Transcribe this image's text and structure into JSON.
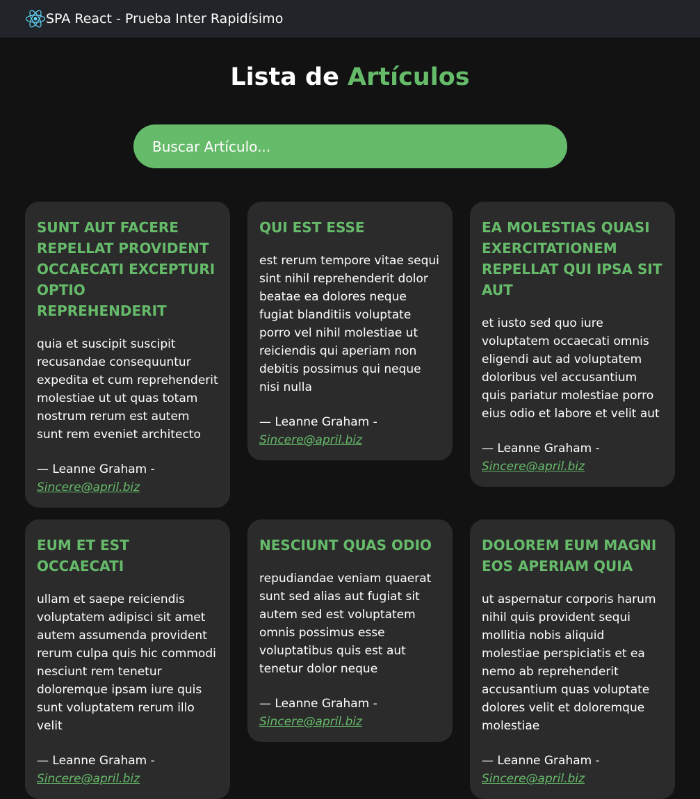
{
  "navbar": {
    "brand": "SPA React - Prueba Inter Rapidísimo",
    "logo_icon": "react-atom-icon",
    "logo_color": "#61dafb"
  },
  "title": {
    "prefix": "Lista de",
    "accent": "Artículos"
  },
  "search": {
    "placeholder": "Buscar Artículo..."
  },
  "colors": {
    "accent": "#66bb6a",
    "background": "#121212",
    "card": "#2b2b2b",
    "navbar": "#212428"
  },
  "articles": [
    {
      "title": "sunt aut facere repellat provident occaecati excepturi optio reprehenderit",
      "body": "quia et suscipit suscipit recusandae consequuntur expedita et cum reprehenderit molestiae ut ut quas totam nostrum rerum est autem sunt rem eveniet architecto",
      "author": "— Leanne Graham -",
      "email": "Sincere@april.biz"
    },
    {
      "title": "qui est esse",
      "body": "est rerum tempore vitae sequi sint nihil reprehenderit dolor beatae ea dolores neque fugiat blanditiis voluptate porro vel nihil molestiae ut reiciendis qui aperiam non debitis possimus qui neque nisi nulla",
      "author": "— Leanne Graham -",
      "email": "Sincere@april.biz"
    },
    {
      "title": "ea molestias quasi exercitationem repellat qui ipsa sit aut",
      "body": "et iusto sed quo iure voluptatem occaecati omnis eligendi aut ad voluptatem doloribus vel accusantium quis pariatur molestiae porro eius odio et labore et velit aut",
      "author": "— Leanne Graham -",
      "email": "Sincere@april.biz"
    },
    {
      "title": "eum et est occaecati",
      "body": "ullam et saepe reiciendis voluptatem adipisci sit amet autem assumenda provident rerum culpa quis hic commodi nesciunt rem tenetur doloremque ipsam iure quis sunt voluptatem rerum illo velit",
      "author": "— Leanne Graham -",
      "email": "Sincere@april.biz"
    },
    {
      "title": "nesciunt quas odio",
      "body": "repudiandae veniam quaerat sunt sed alias aut fugiat sit autem sed est voluptatem omnis possimus esse voluptatibus quis est aut tenetur dolor neque",
      "author": "— Leanne Graham -",
      "email": "Sincere@april.biz"
    },
    {
      "title": "dolorem eum magni eos aperiam quia",
      "body": "ut aspernatur corporis harum nihil quis provident sequi mollitia nobis aliquid molestiae perspiciatis et ea nemo ab reprehenderit accusantium quas voluptate dolores velit et doloremque molestiae",
      "author": "— Leanne Graham -",
      "email": "Sincere@april.biz"
    }
  ]
}
